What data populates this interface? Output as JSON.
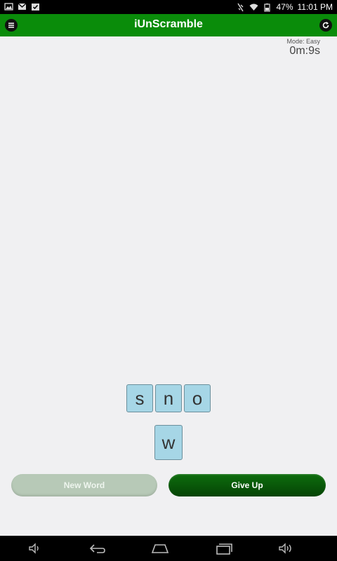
{
  "status_bar": {
    "battery": "47%",
    "time": "11:01 PM"
  },
  "app_bar": {
    "title": "iUnScramble",
    "menu_icon": "menu-icon",
    "refresh_icon": "refresh-icon"
  },
  "game": {
    "mode_label": "Mode: Easy",
    "timer": "0m:9s",
    "scrambled_letters": [
      "s",
      "n",
      "o"
    ],
    "answer_letters": [
      "w"
    ]
  },
  "buttons": {
    "new_word": "New Word",
    "give_up": "Give Up"
  },
  "colors": {
    "app_bar": "#0a8c0a",
    "tile": "#a6d6e6",
    "give_up": "#0a5a0a",
    "new_word_disabled": "#b7c9b7"
  }
}
